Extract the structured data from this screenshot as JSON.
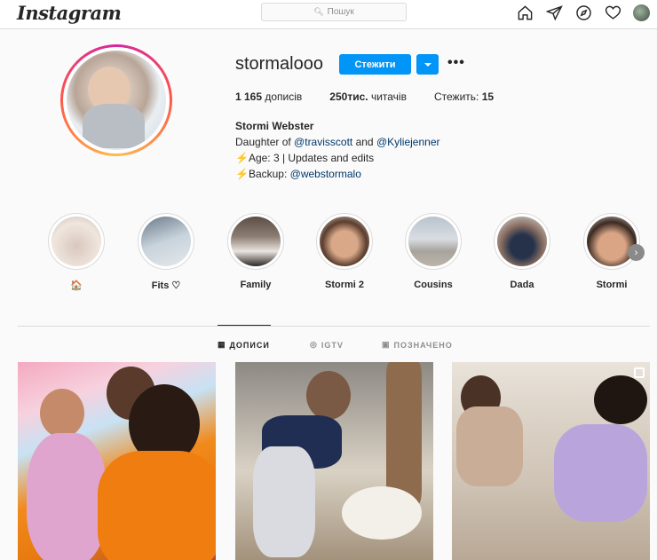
{
  "nav": {
    "logo": "Instagram",
    "search_placeholder": "Пошук",
    "icons": [
      "home-icon",
      "direct-icon",
      "explore-icon",
      "activity-heart-icon",
      "profile-avatar"
    ]
  },
  "profile": {
    "username": "stormalooo",
    "follow_label": "Стежити",
    "posts_count": "1 165",
    "posts_label": "дописів",
    "followers_count": "250тис.",
    "followers_label": "читачів",
    "following_label": "Стежить:",
    "following_count": "15",
    "name": "Stormi Webster",
    "bio_line1_prefix": "Daughter of ",
    "bio_link1": "@travisscott",
    "bio_line1_mid": " and ",
    "bio_link2": "@Kyliejenner",
    "bio_line2": "Age: 3 | Updates and edits",
    "bio_line3_prefix": "Backup: ",
    "bio_link3": "@webstormalo",
    "bolt": "⚡"
  },
  "highlights": [
    {
      "label": "🏠"
    },
    {
      "label": "Fits ♡"
    },
    {
      "label": "Family"
    },
    {
      "label": "Stormi 2"
    },
    {
      "label": "Cousins"
    },
    {
      "label": "Dada"
    },
    {
      "label": "Stormi"
    }
  ],
  "tabs": [
    {
      "label": "ДОПИСИ",
      "icon": "grid-icon",
      "active": true
    },
    {
      "label": "IGTV",
      "icon": "igtv-icon",
      "active": false
    },
    {
      "label": "ПОЗНАЧЕНО",
      "icon": "tagged-icon",
      "active": false
    }
  ],
  "colors": {
    "accent": "#0095f6",
    "link": "#00376b"
  }
}
